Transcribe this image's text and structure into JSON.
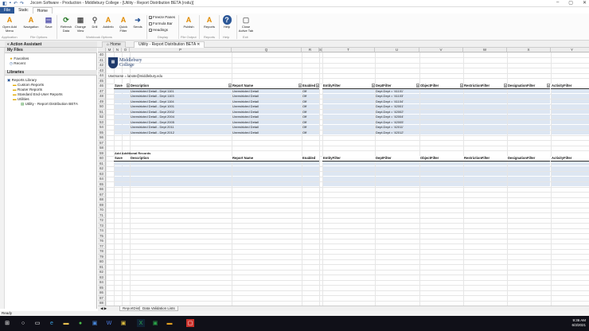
{
  "titlebar": {
    "title": "Jocom Software - Production - Middlebury College - [Utility - Report Distribution BETA (rodu)]"
  },
  "menu": {
    "file": "File",
    "items": [
      "Static",
      "Home"
    ]
  },
  "ribbon": {
    "buttons": [
      {
        "label": "Open Add\nMenu",
        "icon": "A"
      },
      {
        "label": "Navigation",
        "icon": "A"
      },
      {
        "label": "Save",
        "icon": "▤"
      },
      {
        "label": "Refresh\nData",
        "icon": "⟳"
      },
      {
        "label": "Change\nView",
        "icon": "▦"
      },
      {
        "label": "Drill",
        "icon": "⚲"
      },
      {
        "label": "Addinfo",
        "icon": "A"
      },
      {
        "label": "Quick\nFilter",
        "icon": "A"
      },
      {
        "label": "Sends",
        "icon": "➜"
      },
      {
        "label": "Publish",
        "icon": "A"
      },
      {
        "label": "Reports",
        "icon": "A"
      },
      {
        "label": "Help",
        "icon": "?"
      },
      {
        "label": "Close\nActive Tab",
        "icon": "▢"
      }
    ],
    "checks": [
      {
        "label": "Freeze Panes",
        "checked": true
      },
      {
        "label": "Formula Bar",
        "checked": false
      },
      {
        "label": "Headings",
        "checked": true
      }
    ],
    "groups": [
      "Application",
      "File Options",
      "Workbook Options",
      "Display",
      "File Output",
      "Reports",
      "Help",
      "Exit"
    ]
  },
  "tabs": [
    "Home",
    "Utility - Report Distribution BETA"
  ],
  "sidebar": {
    "title": "Action Assistant",
    "myfiles": "My Files",
    "myfiles_items": [
      "Favorites",
      "Recent"
    ],
    "libraries": "Libraries",
    "tree": [
      "Reports Library",
      "Custom Reports",
      "Router Reports",
      "Standard End-User Reports",
      "Utilities",
      "Utility - Report Distribution BETA"
    ]
  },
  "columns": [
    "M",
    "N",
    "O",
    "P",
    "Q",
    "R",
    "S",
    "T",
    "U",
    "V",
    "W",
    "X",
    "Y",
    "Z"
  ],
  "rows": [
    "40",
    "41",
    "42",
    "43",
    "44",
    "45",
    "46",
    "47",
    "48",
    "49",
    "50",
    "51",
    "52",
    "53",
    "54",
    "55",
    "56",
    "57",
    "58",
    "59",
    "60",
    "61",
    "62",
    "63",
    "64",
    "65",
    "66",
    "67",
    "68",
    "69",
    "70",
    "71",
    "72",
    "73",
    "74",
    "75",
    "76",
    "77",
    "78",
    "79",
    "80",
    "81",
    "82",
    "83",
    "84",
    "85",
    "86",
    "87",
    "88",
    "89"
  ],
  "logo": {
    "line1": "Middlebury",
    "line2": "College",
    "username": "Username = lanote@middlebury.edu"
  },
  "headers": [
    "Save",
    "Description",
    "Report Name",
    "Enabled",
    "EntityFilter",
    "DeptFilter",
    "ObjectFilter",
    "RestrictionFilter",
    "DesignationFilter",
    "ActivityFilter"
  ],
  "records": [
    {
      "desc": "Unrestricted Detail - Dept 1101",
      "report": "Unrestricted Detail",
      "enabled": "Off",
      "dept": "Dept.Dept = '41101'"
    },
    {
      "desc": "Unrestricted Detail - Dept 1103",
      "report": "Unrestricted Detail",
      "enabled": "Off",
      "dept": "Dept.Dept = '41103'"
    },
    {
      "desc": "Unrestricted Detail - Dept 1104",
      "report": "Unrestricted Detail",
      "enabled": "Off",
      "dept": "Dept.Dept = '41104'"
    },
    {
      "desc": "Unrestricted Detail - Dept 1001",
      "report": "Unrestricted Detail",
      "enabled": "Off",
      "dept": "Dept.Dept = '42001'"
    },
    {
      "desc": "Unrestricted Detail - Dept 2002",
      "report": "Unrestricted Detail",
      "enabled": "Off",
      "dept": "Dept.Dept = '42002'"
    },
    {
      "desc": "Unrestricted Detail - Dept 2004",
      "report": "Unrestricted Detail",
      "enabled": "Off",
      "dept": "Dept.Dept = '42004'"
    },
    {
      "desc": "Unrestricted Detail - Dept 2005",
      "report": "Unrestricted Detail",
      "enabled": "Off",
      "dept": "Dept.Dept = '42005'"
    },
    {
      "desc": "Unrestricted Detail - Dept 2011",
      "report": "Unrestricted Detail",
      "enabled": "Off",
      "dept": "Dept.Dept = '42011'"
    },
    {
      "desc": "Unrestricted Detail - Dept 2012",
      "report": "Unrestricted Detail",
      "enabled": "Off",
      "dept": "Dept.Dept = '42012'"
    }
  ],
  "add_section": "Add Additional Records",
  "sheets": [
    "ReportDist",
    "Data Validation Lists"
  ],
  "status": "Ready",
  "clock": {
    "time": "9:36 AM",
    "date": "6/3/2021"
  }
}
